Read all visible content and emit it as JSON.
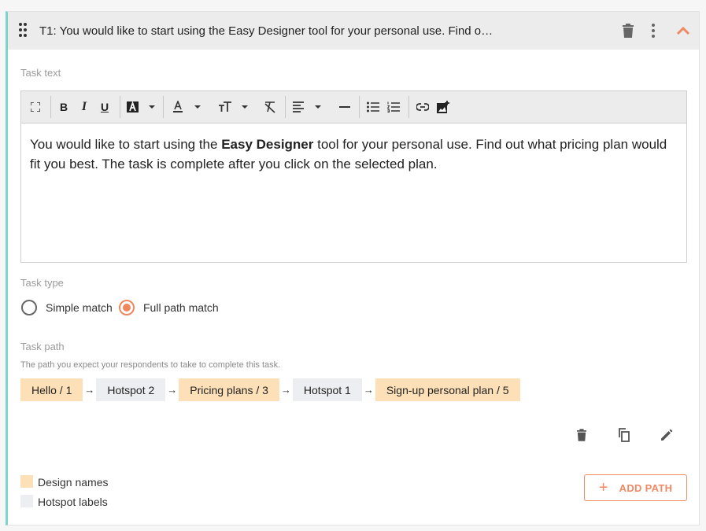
{
  "task": {
    "title": "T1: You would like to start using the Easy Designer tool for your personal use. Find o…"
  },
  "editor": {
    "label": "Task text",
    "content_before": "You would like to start using the ",
    "content_bold": "Easy Designer",
    "content_after": " tool for your personal use. Find out what pricing plan would fit you best. The task is complete after you click on the selected plan.",
    "toolbar": {
      "bold": "B",
      "italic": "I",
      "underline": "U"
    }
  },
  "task_type": {
    "label": "Task type",
    "options": [
      {
        "label": "Simple match",
        "selected": false
      },
      {
        "label": "Full path match",
        "selected": true
      }
    ]
  },
  "task_path": {
    "label": "Task path",
    "description": "The path you expect your respondents to take to complete this task.",
    "steps": [
      {
        "label": "Hello / 1",
        "kind": "design"
      },
      {
        "label": "Hotspot 2",
        "kind": "hotspot"
      },
      {
        "label": "Pricing plans / 3",
        "kind": "design"
      },
      {
        "label": "Hotspot 1",
        "kind": "hotspot"
      },
      {
        "label": "Sign-up personal plan / 5",
        "kind": "design"
      }
    ],
    "arrow": "→"
  },
  "legend": {
    "design": "Design names",
    "hotspot": "Hotspot labels"
  },
  "add_path": {
    "plus": "+",
    "label": "ADD PATH"
  },
  "colors": {
    "accent": "#ef8a64",
    "design_chip": "#fde0b8",
    "hotspot_chip": "#eceef1",
    "card_left_border": "#7fd3cd"
  }
}
